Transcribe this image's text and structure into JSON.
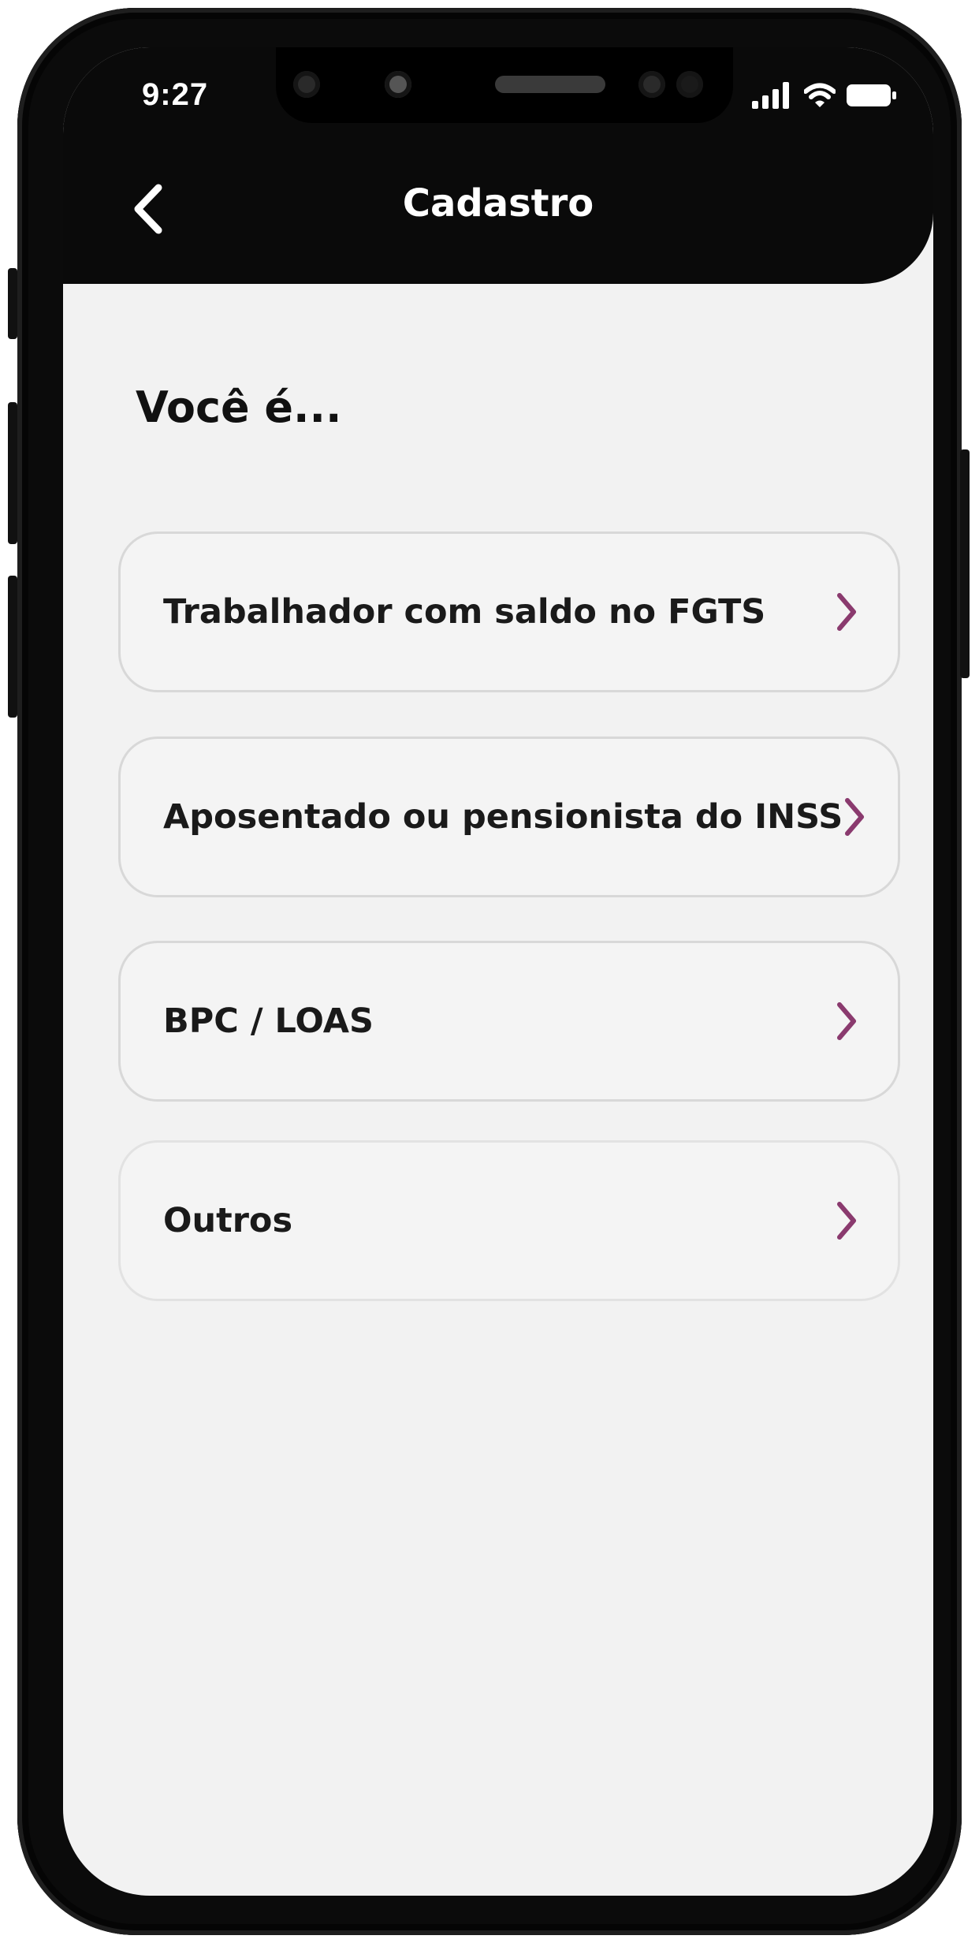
{
  "status_bar": {
    "time": "9:27",
    "icons": [
      "signal-icon",
      "wifi-icon",
      "battery-icon"
    ]
  },
  "header": {
    "back_icon": "chevron-left-icon",
    "title": "Cadastro"
  },
  "main": {
    "heading": "Você é...",
    "options": [
      {
        "label": "Trabalhador com saldo no FGTS"
      },
      {
        "label": "Aposentado ou pensionista do INSS"
      },
      {
        "label": "BPC / LOAS"
      },
      {
        "label": "Outros"
      }
    ]
  },
  "colors": {
    "header_bg": "#0a0a0a",
    "screen_bg": "#f2f2f2",
    "chevron_accent": "#8a3a6e"
  }
}
